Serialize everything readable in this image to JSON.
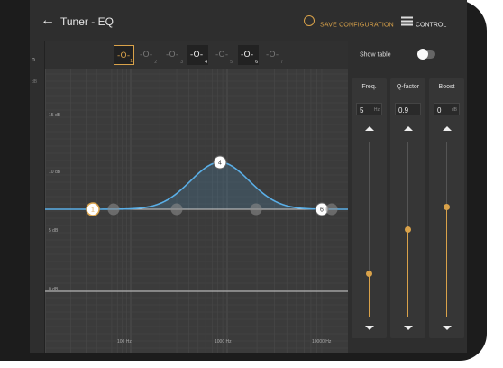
{
  "header": {
    "back_icon": "arrow-left-icon",
    "title": "Tuner - EQ",
    "save_label": "SAVE CONFIGURATION",
    "save_icon": "save-config-icon",
    "control_label": "CONTROL",
    "control_icon": "sliders-icon",
    "accent": "#d9a24a"
  },
  "left_panel": {
    "label": "n",
    "sub": "dB"
  },
  "bands": [
    {
      "num": "1",
      "selected": true,
      "active": true
    },
    {
      "num": "2",
      "selected": false,
      "active": false
    },
    {
      "num": "3",
      "selected": false,
      "active": false
    },
    {
      "num": "4",
      "selected": true,
      "active": true
    },
    {
      "num": "5",
      "selected": false,
      "active": false
    },
    {
      "num": "6",
      "selected": true,
      "active": true
    },
    {
      "num": "7",
      "selected": false,
      "active": false
    }
  ],
  "chart": {
    "y_labels": [
      "15 dB",
      "10 dB",
      "5 dB",
      "0 dB"
    ],
    "x_labels": [
      "100 Hz",
      "1000 Hz",
      "10000 Hz"
    ],
    "nodes": [
      {
        "label": "1",
        "active": true,
        "highlight": true
      },
      {
        "label": "",
        "active": false
      },
      {
        "label": "",
        "active": false
      },
      {
        "label": "4",
        "active": true
      },
      {
        "label": "",
        "active": false
      },
      {
        "label": "6",
        "active": true
      },
      {
        "label": "",
        "active": false
      }
    ],
    "curve_color": "#5aaee6"
  },
  "controls": {
    "show_table_label": "Show table",
    "show_table_on": false,
    "freq": {
      "label": "Freq.",
      "value": "5",
      "unit": "Hz",
      "level": 0.25
    },
    "qfactor": {
      "label": "Q-factor",
      "value": "0.9",
      "unit": "",
      "level": 0.5
    },
    "boost": {
      "label": "Boost",
      "value": "0",
      "unit": "dB",
      "level": 0.63
    }
  }
}
